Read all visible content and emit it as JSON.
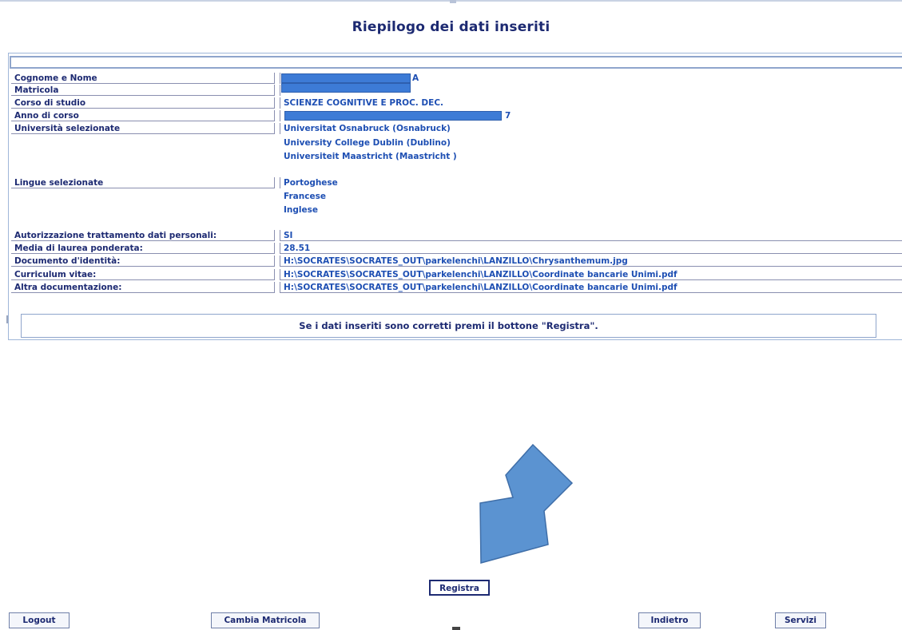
{
  "page": {
    "title": "Riepilogo dei dati inseriti"
  },
  "fields": [
    {
      "label": "Cognome e Nome",
      "value": "A",
      "redacted": true
    },
    {
      "label": "Matricola",
      "value": "",
      "redacted": true
    },
    {
      "label": "Corso di studio",
      "value": "SCIENZE COGNITIVE E PROC. DEC."
    },
    {
      "label": "Anno di corso",
      "value": "7",
      "redacted": true
    },
    {
      "label": "Università selezionate",
      "values": [
        "Universitat Osnabruck (Osnabruck)",
        "University College Dublin (Dublino)",
        "Universiteit Maastricht (Maastricht )"
      ]
    },
    {
      "label": "Lingue selezionate",
      "values": [
        "Portoghese",
        "Francese",
        "Inglese"
      ]
    },
    {
      "label": "Autorizzazione trattamento dati personali:",
      "value": "SI"
    },
    {
      "label": "Media di laurea ponderata:",
      "value": "28.51"
    },
    {
      "label": "Documento d'identità:",
      "value": "H:\\SOCRATES\\SOCRATES_OUT\\parkelenchi\\LANZILLO\\Chrysanthemum.jpg"
    },
    {
      "label": "Curriculum vitae:",
      "value": "H:\\SOCRATES\\SOCRATES_OUT\\parkelenchi\\LANZILLO\\Coordinate bancarie Unimi.pdf"
    },
    {
      "label": "Altra documentazione:",
      "value": "H:\\SOCRATES\\SOCRATES_OUT\\parkelenchi\\LANZILLO\\Coordinate bancarie Unimi.pdf"
    }
  ],
  "message": "Se i dati inseriti sono corretti premi il bottone \"Registra\".",
  "buttons": {
    "registra": "Registra",
    "logout": "Logout",
    "cambia_matricola": "Cambia Matricola",
    "indietro": "Indietro",
    "servizi": "Servizi"
  },
  "colors": {
    "annotation_arrow": "#5b93d1",
    "redaction": "#3d7bd6",
    "text": "#1d2a72",
    "value_text": "#1e4fb3"
  },
  "annotation": {
    "icon": "arrow-down-left-icon"
  }
}
